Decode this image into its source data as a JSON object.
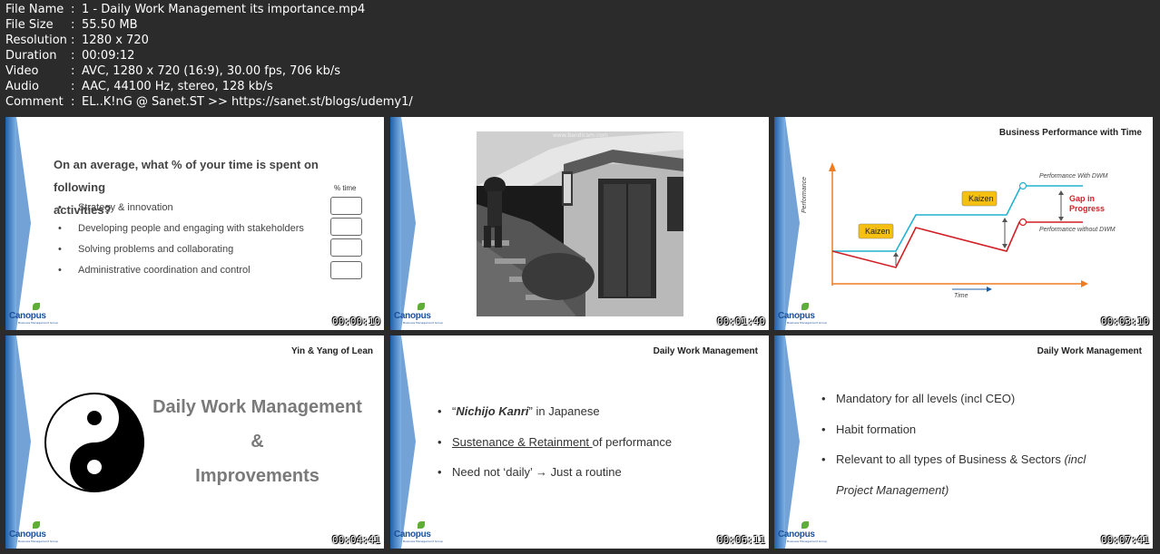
{
  "metadata": [
    {
      "label": "File Name",
      "value": "1 - Daily Work Management its importance.mp4"
    },
    {
      "label": "File Size",
      "value": "55.50 MB"
    },
    {
      "label": "Resolution",
      "value": "1280 x 720"
    },
    {
      "label": "Duration",
      "value": "00:09:12"
    },
    {
      "label": "Video",
      "value": "AVC, 1280 x 720 (16:9), 30.00 fps, 706 kb/s"
    },
    {
      "label": "Audio",
      "value": "AAC, 44100 Hz, stereo, 128 kb/s"
    },
    {
      "label": "Comment",
      "value": "EL..K!nG @ Sanet.ST >> https://sanet.st/blogs/udemy1/"
    }
  ],
  "colon": ":",
  "logo": {
    "word": "Canopus",
    "sub": "Business Management Group"
  },
  "thumbs": [
    {
      "timecode": "00:00:10",
      "question_line1": "On an average, what % of your time is spent on following",
      "question_line2": "activities?",
      "pct_label": "% time",
      "options": [
        "Strategy & innovation",
        "Developing people and engaging with stakeholders",
        "Solving problems and collaborating",
        "Administrative coordination and control"
      ]
    },
    {
      "timecode": "00:01:40",
      "watermark": "www.Bandicam.com"
    },
    {
      "timecode": "00:03:10",
      "title": "Business Performance with Time",
      "labels": {
        "with_dwm": "Performance With DWM",
        "without_dwm": "Performance without DWM",
        "kaizen": "Kaizen",
        "gap_line1": "Gap in",
        "gap_line2": "Progress",
        "y_axis": "Performance",
        "x_axis": "Time"
      }
    },
    {
      "timecode": "00:04:41",
      "title": "Yin & Yang of Lean",
      "line1": "Daily Work Management",
      "line2": "&",
      "line3": "Improvements"
    },
    {
      "timecode": "00:06:11",
      "title": "Daily Work Management",
      "b1_open": "“",
      "b1_bold": "Nichijo Kanri",
      "b1_rest": "” in Japanese",
      "b2_underline": "Sustenance & Retainment ",
      "b2_rest": "of performance",
      "b3": "Need not ‘daily’ → Just a routine"
    },
    {
      "timecode": "00:07:41",
      "title": "Daily Work Management",
      "b1": "Mandatory for all levels (incl CEO)",
      "b2": "Habit formation",
      "b3_main": "Relevant to all types of Business & Sectors ",
      "b3_italic": "(incl",
      "b3_cont": "Project Management)"
    }
  ],
  "bullet": "•",
  "colors": {
    "background": "#2b2b2b",
    "accent_blue": "#1f5fa8",
    "cyan_line": "#1fb3d1",
    "red_line": "#d11f26",
    "kaizen_box": "#f5c010",
    "axis_orange": "#f07c22"
  }
}
